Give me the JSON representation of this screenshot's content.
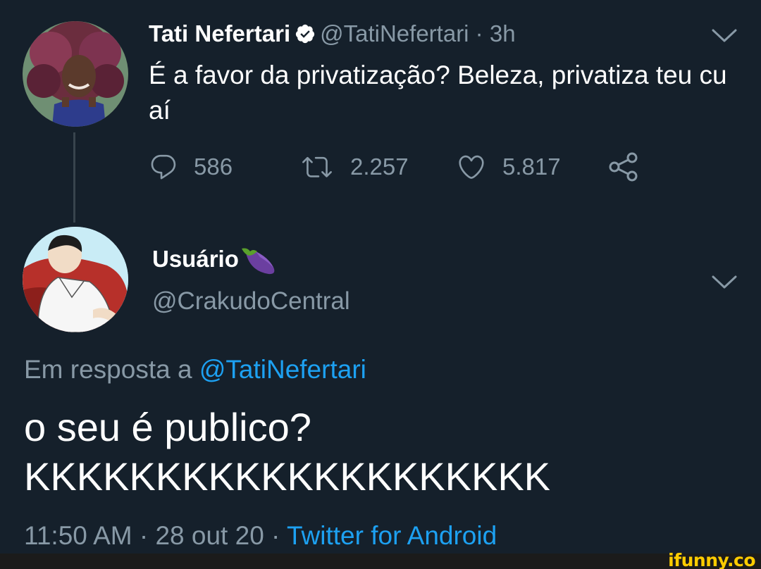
{
  "parent_tweet": {
    "author_name": "Tati Nefertari",
    "verified_icon": "verified-badge-icon",
    "handle_meta": "@TatiNefertari · 3h",
    "text": "É a favor da privatização? Beleza, privatiza teu cu aí",
    "replies": "586",
    "retweets": "2.257",
    "likes": "5.817",
    "icons": {
      "reply": "speech-bubble-icon",
      "retweet": "retweet-arrows-icon",
      "like": "heart-icon",
      "share": "share-nodes-icon",
      "menu": "chevron-down-icon"
    }
  },
  "reply_tweet": {
    "author_name": "Usuário",
    "name_emoji": "eggplant-emoji",
    "handle": "@CrakudoCentral",
    "reply_prefix": "Em resposta a",
    "reply_mention": "@TatiNefertari",
    "text_line1": "o seu é publico?",
    "text_line2": "KKKKKKKKKKKKKKKKKKKK",
    "timestamp": "11:50 AM · 28 out 20 · ",
    "source": "Twitter for Android"
  },
  "watermark": {
    "text": "ifunny.co"
  },
  "colors": {
    "background": "#15202b",
    "secondary_text": "#8899a6",
    "accent": "#1da1f2",
    "watermark": "#ffcc00"
  }
}
